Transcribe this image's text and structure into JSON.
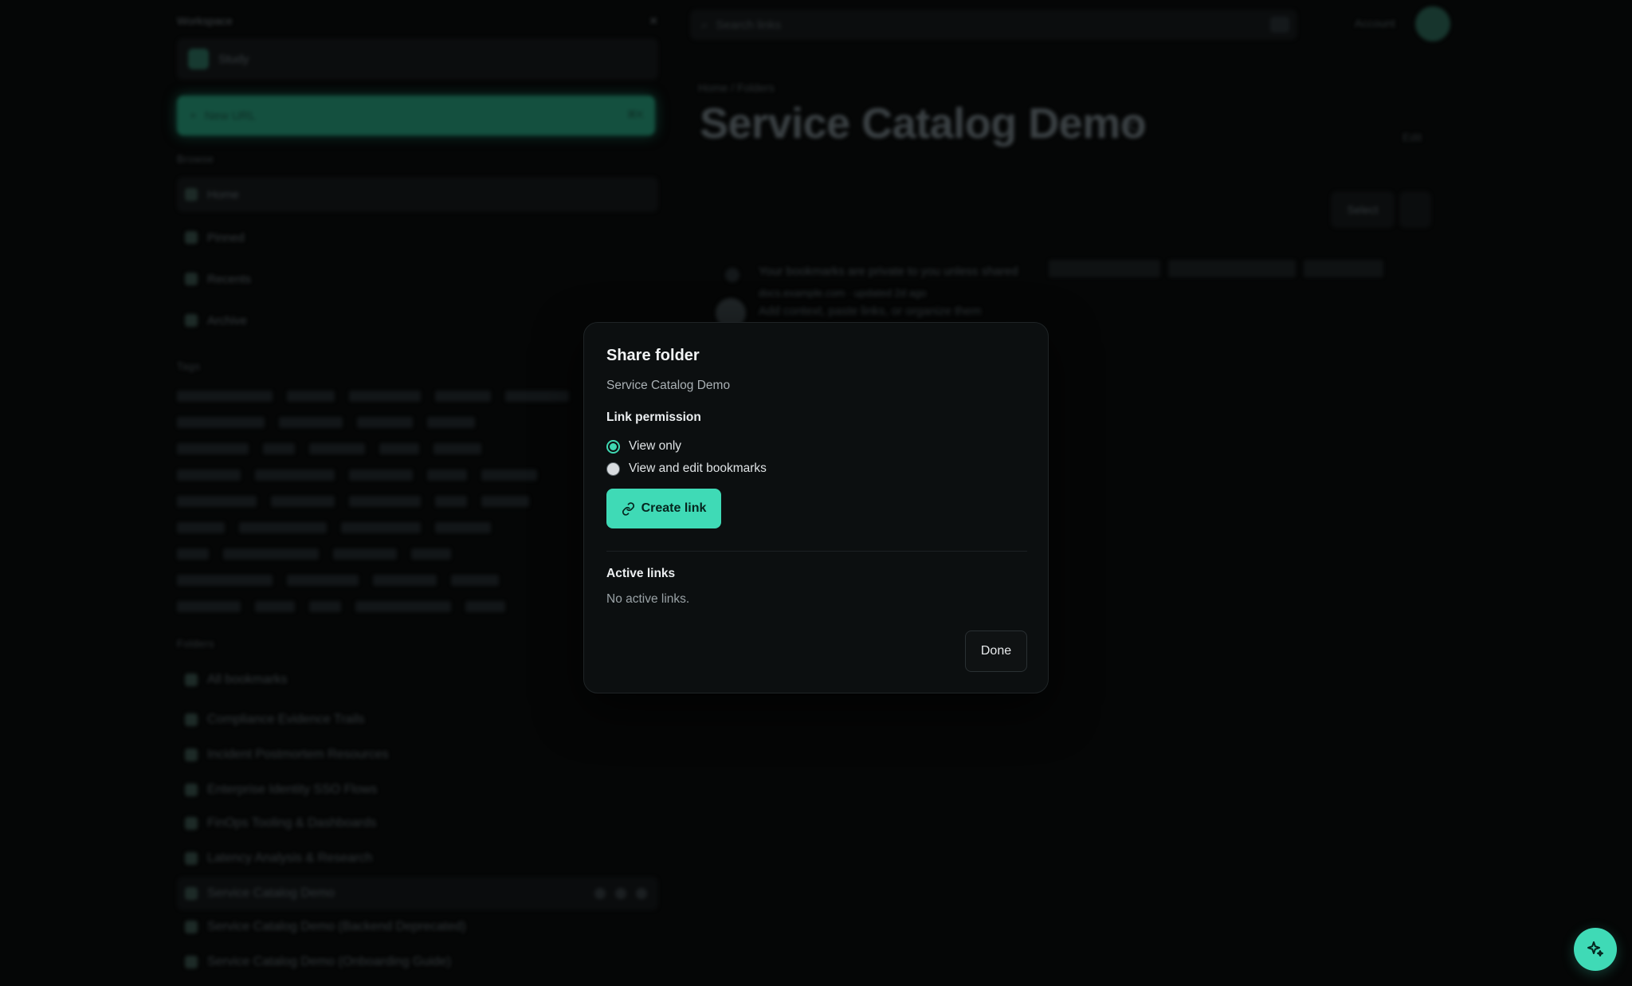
{
  "background": {
    "sidebar": {
      "header_label": "Workspace",
      "workspace_name": "Study",
      "new_button_label": "New URL",
      "new_button_shortcut": "⌘K",
      "sections": {
        "nav_label": "Browse",
        "tags_label": "Tags",
        "folders_label": "Folders"
      },
      "nav_items": [
        {
          "label": "Home"
        },
        {
          "label": "Pinned"
        },
        {
          "label": "Recents"
        },
        {
          "label": "Archive"
        }
      ],
      "folders": [
        {
          "label": "All bookmarks"
        },
        {
          "label": "Compliance Evidence Trails"
        },
        {
          "label": "Incident Postmortem Resources"
        },
        {
          "label": "Enterprise Identity SSO Flows"
        },
        {
          "label": "FinOps Tooling & Dashboards"
        },
        {
          "label": "Latency Analysis & Research"
        },
        {
          "label": "Service Catalog Demo"
        },
        {
          "label": "Service Catalog Demo (Backend Deprecated)"
        },
        {
          "label": "Service Catalog Demo (Onboarding Guide)"
        }
      ]
    },
    "main": {
      "search_placeholder": "Search links",
      "user_name": "Account",
      "breadcrumb": "Home  /  Folders",
      "page_title": "Service Catalog Demo",
      "edit_label": "Edit",
      "select_label": "Select",
      "bookmark_title": "Your bookmarks are private to you unless shared",
      "bookmark_meta": "docs.example.com · updated 2d ago",
      "bookmark_desc": "Add context, paste links, or organize them"
    }
  },
  "modal": {
    "title": "Share folder",
    "subtitle": "Service Catalog Demo",
    "permission_label": "Link permission",
    "options": [
      {
        "label": "View only",
        "checked": true
      },
      {
        "label": "View and edit bookmarks",
        "checked": false
      }
    ],
    "create_button": "Create link",
    "create_icon": "link-icon",
    "active_links_label": "Active links",
    "active_links_empty": "No active links.",
    "done_button": "Done"
  },
  "fab": {
    "icon": "sparkle-icon"
  },
  "colors": {
    "accent": "#3fdab6",
    "modal_bg": "#0c0f10",
    "page_bg": "#050606"
  }
}
